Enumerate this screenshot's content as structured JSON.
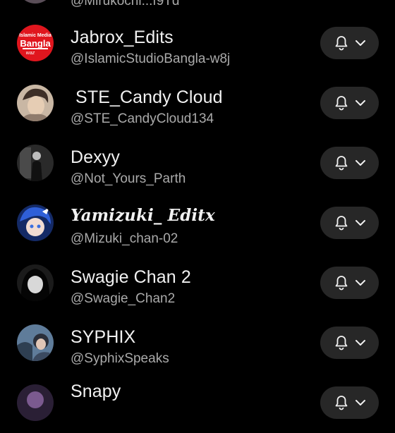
{
  "channels": [
    {
      "name": "",
      "handle": "@Mirukochi...f9Td",
      "avatar": "avatar-partial"
    },
    {
      "name": "Jabrox_Edits",
      "handle": "@IslamicStudioBangla-w8j",
      "avatar": "islamic-media-logo",
      "logo_text": [
        "Islamic Media",
        "Bangla",
        "waz"
      ]
    },
    {
      "name": " STE_Candy Cloud",
      "handle": "@STE_CandyCloud134",
      "avatar": "anime-boy"
    },
    {
      "name": "Dexyy",
      "handle": "@Not_Yours_Parth",
      "avatar": "dark-figure"
    },
    {
      "name": "Yamizuki_ Editx",
      "handle": "@Mizuki_chan-02",
      "avatar": "anime-blue-hair"
    },
    {
      "name": "Swagie Chan 2",
      "handle": "@Swagie_Chan2",
      "avatar": "anime-girl-bw"
    },
    {
      "name": "SYPHIX",
      "handle": "@SyphixSpeaks",
      "avatar": "anime-pair"
    },
    {
      "name": "Snapy",
      "handle": "",
      "avatar": "avatar-partial"
    }
  ],
  "icons": {
    "notification": "bell-icon",
    "dropdown": "chevron-down-icon"
  },
  "colors": {
    "background": "#000000",
    "button": "#272727",
    "handle_text": "#aaaaaa",
    "logo_red": "#e0161e"
  }
}
